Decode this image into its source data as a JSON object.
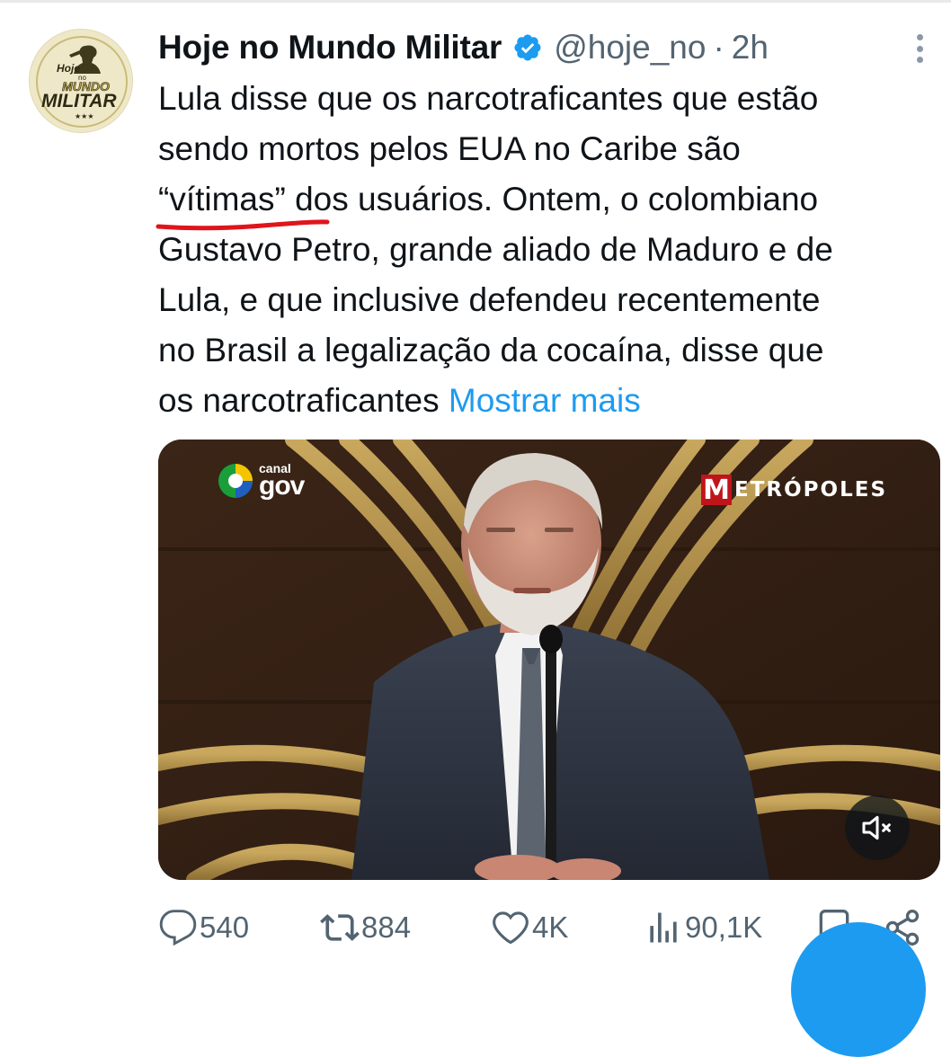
{
  "tweet": {
    "author_name": "Hoje no Mundo Militar",
    "handle": "@hoje_no",
    "separator": "·",
    "time": "2h",
    "avatar_text": [
      "Hoje",
      "no",
      "MUNDO",
      "MILITAR"
    ],
    "text_lines": {
      "l1": "Lula disse que os narcotraficantes que estão",
      "l2": "sendo mortos pelos EUA no Caribe são",
      "l3_highlight": "“vítimas”",
      "l3_rest": " dos usuários. Ontem, o colombiano",
      "l4": "Gustavo Petro, grande aliado de Maduro e de",
      "l5": "Lula, e que inclusive defendeu recentemente",
      "l6": "no Brasil a legalização da cocaína, disse que",
      "l7": "os narcotraficantes "
    },
    "show_more": "Mostrar mais"
  },
  "media": {
    "logo_left_small": "canal",
    "logo_left_big": "gov",
    "logo_right_m": "M",
    "logo_right_rest": "ETRÓPOLES"
  },
  "actions": {
    "replies": "540",
    "reposts": "884",
    "likes": "4K",
    "views": "90,1K"
  },
  "colors": {
    "accent": "#1d9bf0",
    "text": "#0f1419",
    "secondary": "#536471",
    "underline_annotation": "#e0141b"
  },
  "icons": [
    "verified-badge-icon",
    "more-options-icon",
    "mute-icon",
    "reply-icon",
    "repost-icon",
    "like-icon",
    "views-icon",
    "bookmark-icon",
    "share-icon"
  ]
}
